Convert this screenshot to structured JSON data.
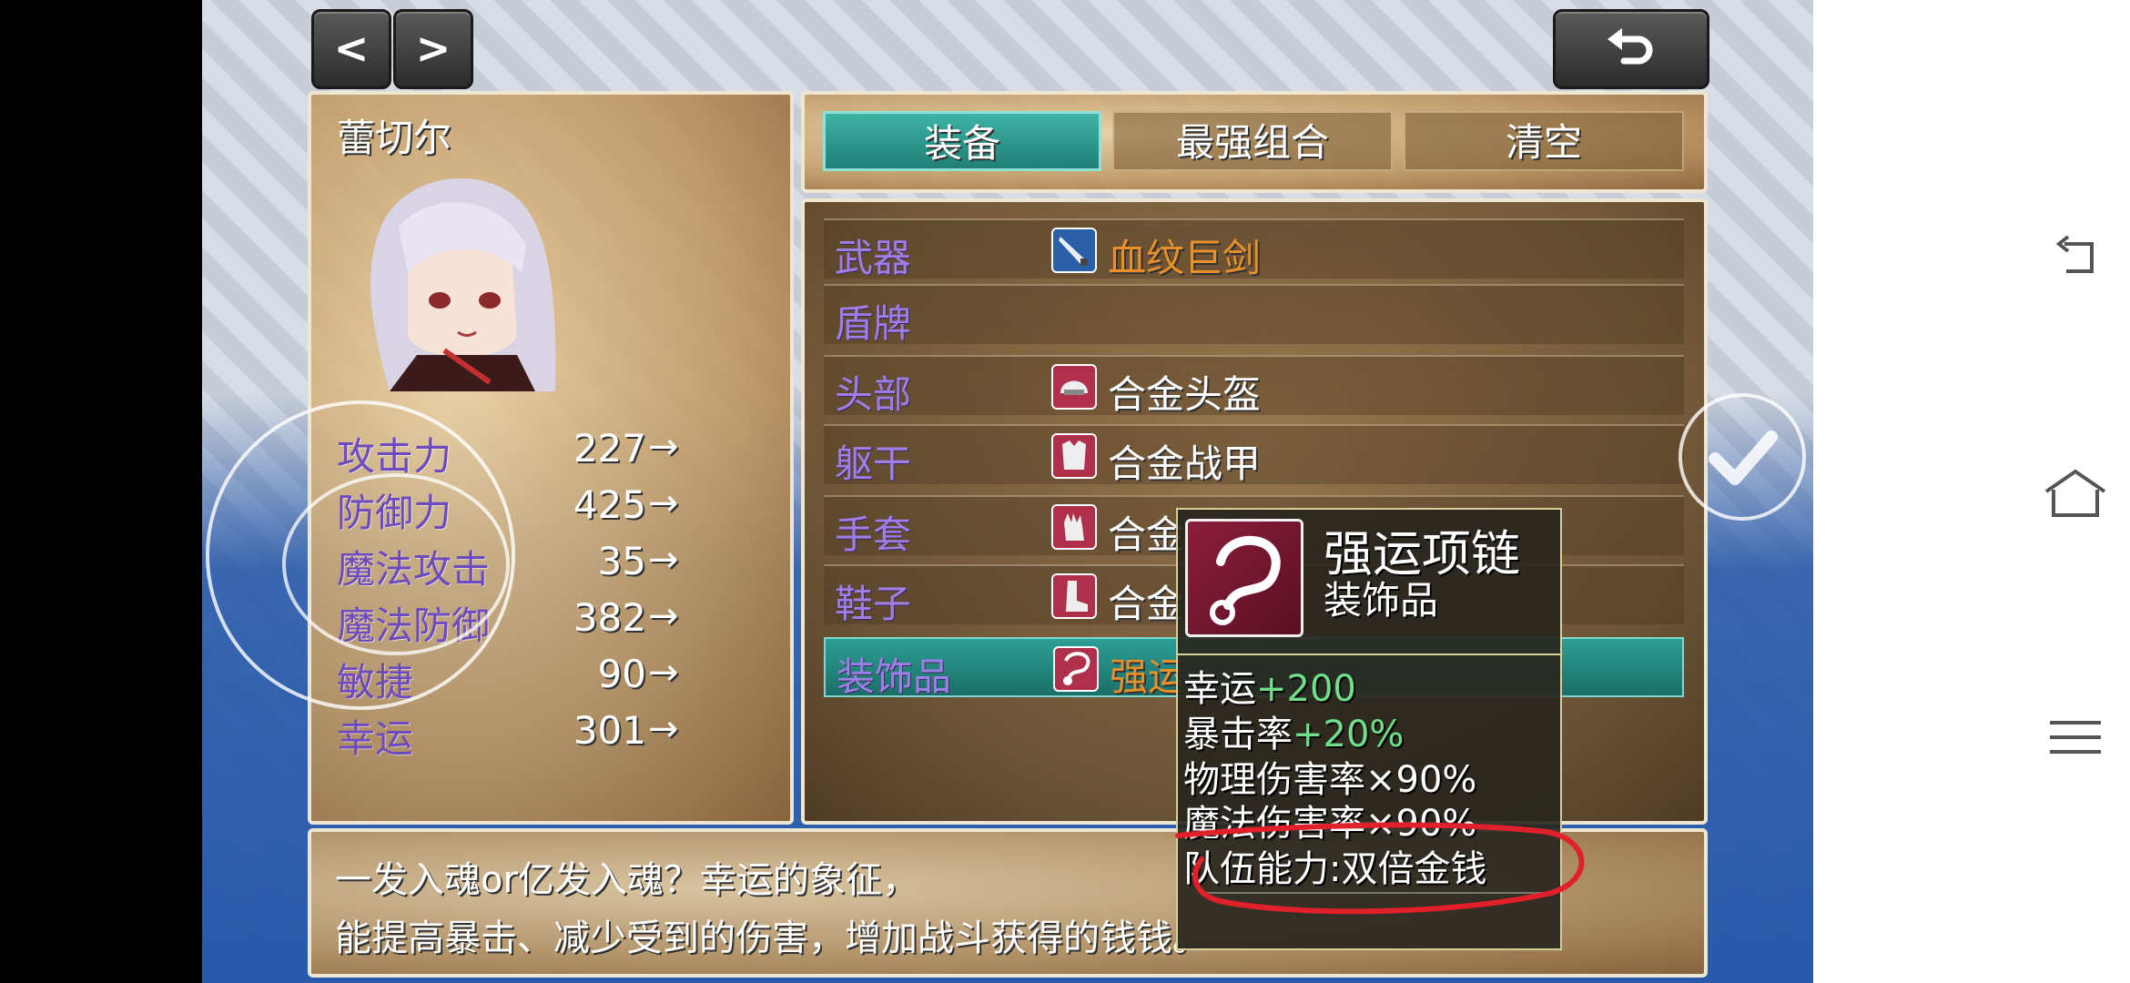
{
  "top_buttons": {
    "prev": "<",
    "next": ">",
    "back_icon": "undo-arrow-icon"
  },
  "character": {
    "name": "蕾切尔",
    "stats": [
      {
        "label": "攻击力",
        "value": "227",
        "arrow": "→"
      },
      {
        "label": "防御力",
        "value": "425",
        "arrow": "→"
      },
      {
        "label": "魔法攻击",
        "value": "35",
        "arrow": "→"
      },
      {
        "label": "魔法防御",
        "value": "382",
        "arrow": "→"
      },
      {
        "label": "敏捷",
        "value": "90",
        "arrow": "→"
      },
      {
        "label": "幸运",
        "value": "301",
        "arrow": "→"
      }
    ]
  },
  "tabs": [
    {
      "label": "装备",
      "active": true
    },
    {
      "label": "最强组合",
      "active": false
    },
    {
      "label": "清空",
      "active": false
    }
  ],
  "slots": [
    {
      "label": "武器",
      "item": "血纹巨剑",
      "icon": "sword-icon",
      "icon_color": "#2b5fa8",
      "rare": true
    },
    {
      "label": "盾牌",
      "item": "",
      "icon": "",
      "icon_color": "",
      "rare": false
    },
    {
      "label": "头部",
      "item": "合金头盔",
      "icon": "helmet-icon",
      "icon_color": "#b0304c",
      "rare": false
    },
    {
      "label": "躯干",
      "item": "合金战甲",
      "icon": "armor-icon",
      "icon_color": "#b0304c",
      "rare": false
    },
    {
      "label": "手套",
      "item": "合金",
      "icon": "glove-icon",
      "icon_color": "#b0304c",
      "rare": false
    },
    {
      "label": "鞋子",
      "item": "合金",
      "icon": "boot-icon",
      "icon_color": "#b0304c",
      "rare": false
    },
    {
      "label": "装饰品",
      "item": "强运",
      "icon": "necklace-icon",
      "icon_color": "#b0304c",
      "rare": true
    }
  ],
  "tooltip": {
    "name": "强运项链",
    "type": "装饰品",
    "icon": "necklace-icon",
    "lines": [
      {
        "text": "幸运",
        "bonus": "+200"
      },
      {
        "text": "暴击率",
        "bonus": "+20%"
      },
      {
        "text": "物理伤害率×90%",
        "bonus": ""
      },
      {
        "text": "魔法伤害率×90%",
        "bonus": ""
      },
      {
        "text": "队伍能力:双倍金钱",
        "bonus": ""
      }
    ]
  },
  "description": {
    "line1": "一发入魂or亿发入魂？幸运的象征，",
    "line2": "能提高暴击、减少受到的伤害，增加战斗获得的钱钱。"
  },
  "colors": {
    "accent_teal": "#2c9f95",
    "stat_purple": "#6e4ac0",
    "rare_orange": "#e8902a",
    "bonus_green": "#6fe08a",
    "annotation_red": "#e0202a"
  },
  "system_nav": {
    "back_icon": "back-icon",
    "home_icon": "home-icon",
    "menu_icon": "menu-icon"
  },
  "overlay": {
    "confirm_icon": "check-icon"
  }
}
